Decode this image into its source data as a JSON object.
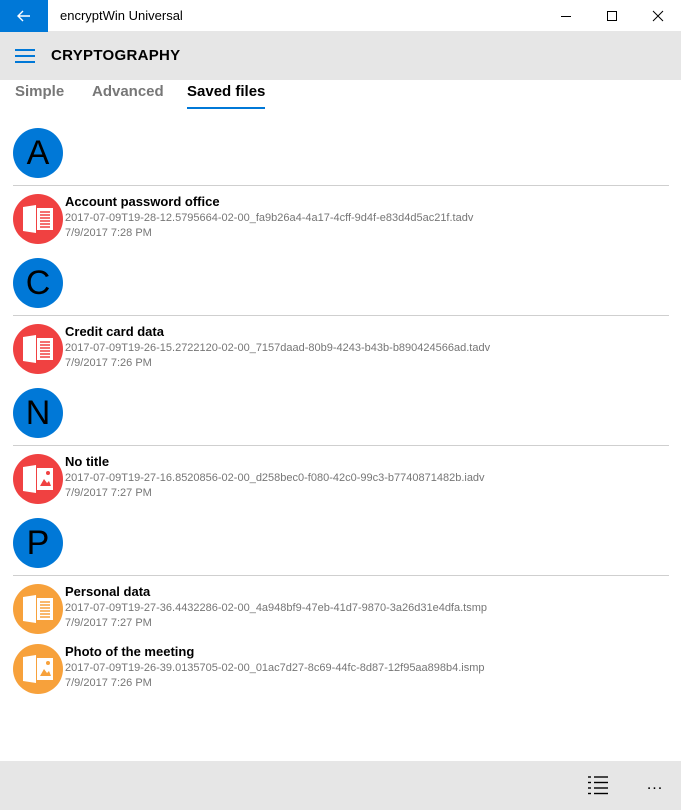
{
  "window": {
    "title": "encryptWin Universal",
    "back_icon": "arrow-left-icon",
    "controls": [
      "minimize-icon",
      "maximize-icon",
      "close-icon"
    ]
  },
  "header": {
    "menu_icon": "hamburger-icon",
    "title": "CRYPTOGRAPHY"
  },
  "tabs": [
    {
      "label": "Simple",
      "active": false
    },
    {
      "label": "Advanced",
      "active": false
    },
    {
      "label": "Saved files",
      "active": true
    }
  ],
  "groups": [
    {
      "letter": "A",
      "items": [
        {
          "title": "Account password office",
          "file": "2017-07-09T19-28-12.5795664-02-00_fa9b26a4-4a17-4cff-9d4f-e83d4d5ac21f.tadv",
          "date": "7/9/2017 7:28 PM",
          "icon": "text-document-icon",
          "color": "#f04141"
        }
      ]
    },
    {
      "letter": "C",
      "items": [
        {
          "title": "Credit card data",
          "file": "2017-07-09T19-26-15.2722120-02-00_7157daad-80b9-4243-b43b-b890424566ad.tadv",
          "date": "7/9/2017 7:26 PM",
          "icon": "text-document-icon",
          "color": "#f04141"
        }
      ]
    },
    {
      "letter": "N",
      "items": [
        {
          "title": "No title",
          "file": "2017-07-09T19-27-16.8520856-02-00_d258bec0-f080-42c0-99c3-b7740871482b.iadv",
          "date": "7/9/2017 7:27 PM",
          "icon": "image-document-icon",
          "color": "#f04141"
        }
      ]
    },
    {
      "letter": "P",
      "items": [
        {
          "title": "Personal data",
          "file": "2017-07-09T19-27-36.4432286-02-00_4a948bf9-47eb-41d7-9870-3a26d31e4dfa.tsmp",
          "date": "7/9/2017 7:27 PM",
          "icon": "text-document-icon",
          "color": "#f7a13b"
        },
        {
          "title": "Photo of the meeting",
          "file": "2017-07-09T19-26-39.0135705-02-00_01ac7d27-8c69-44fc-8d87-12f95aa898b4.ismp",
          "date": "7/9/2017 7:26 PM",
          "icon": "image-document-icon",
          "color": "#f7a13b"
        }
      ]
    }
  ],
  "bottom_bar": {
    "list_icon": "list-view-icon",
    "more_label": "..."
  },
  "colors": {
    "accent": "#0078d7",
    "encrypted_red": "#f04141",
    "encrypted_orange": "#f7a13b",
    "chrome_gray": "#e6e6e6"
  }
}
